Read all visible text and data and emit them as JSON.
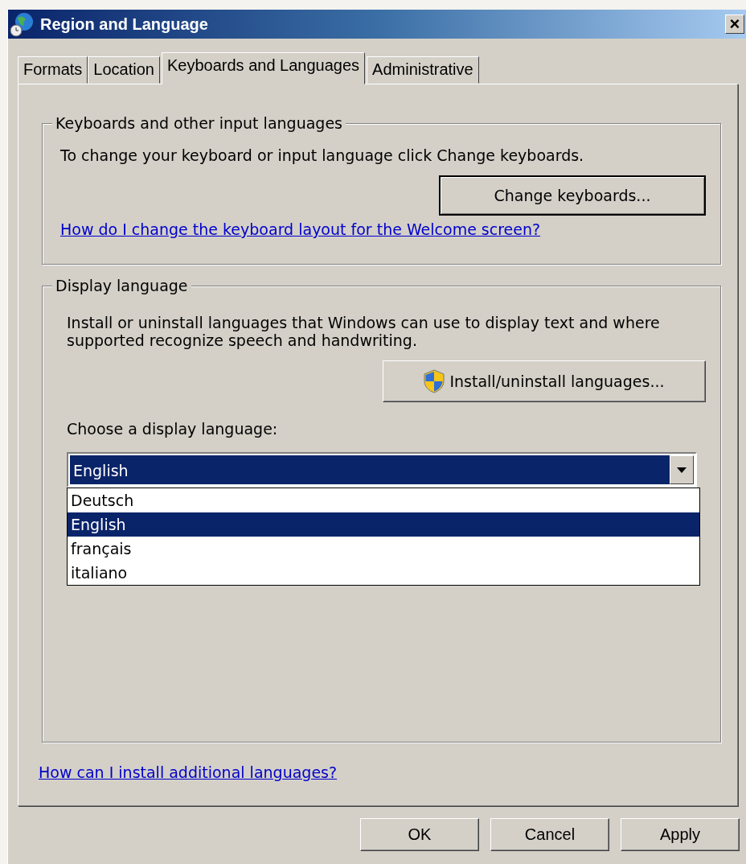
{
  "window": {
    "title": "Region and Language",
    "close": "×"
  },
  "tabs": [
    {
      "label": "Formats",
      "selected": false
    },
    {
      "label": "Location",
      "selected": false
    },
    {
      "label": "Keyboards and Languages",
      "selected": true
    },
    {
      "label": "Administrative",
      "selected": false
    }
  ],
  "keyboards_group": {
    "legend": "Keyboards and other input languages",
    "text": "To change your keyboard or input language click Change keyboards.",
    "button": "Change keyboards...",
    "link": "How do I change the keyboard layout for the Welcome screen?"
  },
  "display_group": {
    "legend": "Display language",
    "text": "Install or uninstall languages that Windows can use to display text and where supported recognize speech and handwriting.",
    "button": "Install/uninstall languages...",
    "combo_label": "Choose a display language:",
    "combo": {
      "value": "English",
      "expanded": true
    },
    "options": [
      {
        "label": "Deutsch",
        "selected": false
      },
      {
        "label": "English",
        "selected": true
      },
      {
        "label": "français",
        "selected": false
      },
      {
        "label": "italiano",
        "selected": false
      }
    ]
  },
  "help_link": "How can I install additional languages?",
  "buttons": [
    {
      "label": "OK"
    },
    {
      "label": "Cancel"
    },
    {
      "label": "Apply"
    }
  ]
}
